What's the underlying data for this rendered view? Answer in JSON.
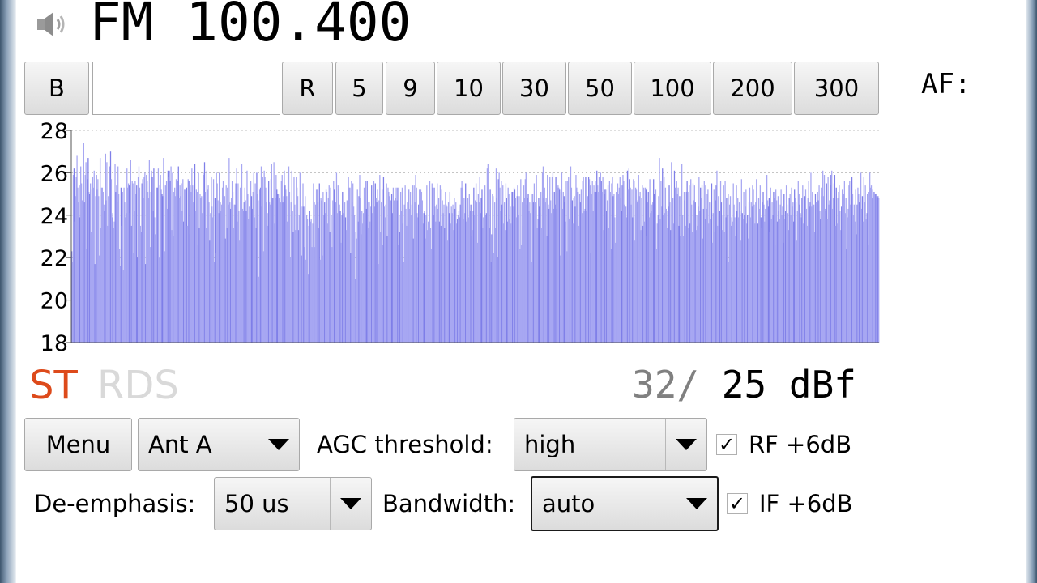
{
  "header": {
    "frequency": "FM 100.400",
    "af_label": "AF:"
  },
  "freq_bar": {
    "bands_label": "B",
    "frequency_input_value": "",
    "reset_label": "R",
    "steps": [
      "5",
      "9",
      "10",
      "30",
      "50",
      "100",
      "200",
      "300"
    ]
  },
  "chart_data": {
    "type": "bar",
    "ylim": [
      18,
      28
    ],
    "yticks": [
      "18",
      "20",
      "22",
      "24",
      "26",
      "28"
    ],
    "grid": true,
    "values": [
      22.3,
      21.8,
      25.9,
      26.2,
      23.7,
      24.9,
      25.8,
      26.8,
      25.3,
      24.6,
      25.4,
      23.9,
      26.3,
      25.5,
      24.7,
      22.7,
      27.4,
      24.6,
      25.9,
      26.5,
      22.4,
      25.7,
      26.7,
      25.1,
      25.0,
      25.5,
      23.2,
      25.2,
      25.8,
      25.3,
      26.1,
      21.7,
      24.9,
      25.9,
      25.2,
      25.7,
      24.9,
      22.1,
      26.7,
      23.4,
      25.3,
      25.3,
      25.1,
      24.5,
      24.2,
      26.9,
      24.7,
      26.5,
      23.5,
      24.9,
      25.2,
      26.3,
      27.0,
      25.7,
      23.9,
      24.1,
      23.4,
      23.7,
      26.4,
      25.1,
      25.4,
      24.6,
      26.3,
      25.0,
      22.4,
      21.6,
      25.3,
      23.5,
      25.1,
      21.4,
      25.3,
      24.6,
      23.9,
      24.1,
      26.2,
      25.3,
      25.5,
      25.4,
      24.1,
      26.6,
      23.5,
      25.6,
      25.5,
      22.2,
      24.2,
      25.6,
      25.0,
      25.4,
      22.0,
      25.8,
      26.3,
      25.3,
      23.5,
      23.2,
      25.5,
      25.7,
      24.8,
      25.8,
      26.0,
      21.7,
      25.9,
      25.6,
      25.1,
      24.8,
      26.6,
      22.5,
      25.1,
      26.1,
      25.8,
      24.2,
      26.2,
      23.9,
      23.1,
      25.0,
      25.3,
      25.3,
      26.2,
      22.0,
      25.4,
      25.9,
      25.2,
      25.0,
      24.9,
      26.7,
      25.4,
      22.3,
      25.4,
      25.6,
      24.3,
      26.1,
      25.8,
      26.1,
      25.6,
      26.3,
      23.3,
      26.0,
      23.0,
      25.1,
      25.3,
      24.9,
      25.7,
      24.3,
      25.6,
      26.3,
      24.8,
      25.4,
      24.9,
      25.5,
      24.2,
      25.7,
      23.7,
      25.2,
      25.2,
      24.3,
      25.3,
      23.5,
      25.7,
      25.6,
      23.1,
      25.4,
      25.1,
      26.2,
      25.4,
      24.6,
      25.7,
      26.4,
      24.2,
      25.2,
      25.1,
      22.6,
      26.0,
      23.4,
      25.0,
      24.8,
      24.9,
      24.1,
      26.0,
      25.9,
      26.5,
      25.1,
      23.4,
      26.1,
      25.2,
      25.4,
      24.6,
      22.8,
      24.1,
      25.8,
      24.4,
      23.9,
      25.7,
      21.8,
      24.8,
      22.2,
      26.0,
      25.5,
      24.7,
      24.1,
      26.0,
      24.6,
      24.2,
      24.5,
      25.3,
      25.6,
      24.2,
      24.9,
      22.9,
      25.4,
      23.4,
      25.3,
      24.5,
      26.7,
      24.6,
      24.3,
      24.8,
      25.6,
      25.1,
      23.4,
      24.5,
      24.5,
      25.5,
      26.2,
      23.7,
      25.5,
      24.2,
      22.8,
      25.3,
      25.4,
      26.4,
      24.3,
      24.2,
      24.6,
      25.3,
      24.7,
      24.2,
      26.1,
      25.0,
      23.8,
      24.4,
      25.2,
      25.6,
      24.9,
      24.3,
      25.1,
      26.0,
      23.9,
      25.5,
      23.4,
      26.0,
      25.0,
      24.7,
      21.1,
      25.2,
      25.3,
      26.3,
      24.4,
      25.8,
      22.3,
      26.1,
      25.8,
      25.3,
      24.6,
      24.1,
      23.5,
      25.6,
      24.6,
      24.5,
      25.7,
      26.4,
      24.8,
      24.8,
      26.5,
      23.6,
      24.8,
      25.9,
      25.2,
      25.0,
      25.0,
      24.8,
      21.3,
      24.6,
      25.6,
      25.9,
      24.6,
      24.9,
      26.1,
      25.4,
      25.2,
      24.9,
      23.7,
      25.9,
      26.3,
      25.1,
      22.0,
      24.6,
      26.1,
      24.2,
      23.2,
      25.8,
      24.5,
      23.3,
      25.8,
      25.3,
      24.9,
      23.3,
      24.0,
      26.0,
      25.5,
      22.1,
      24.4,
      25.5,
      24.4,
      22.5,
      24.9,
      21.9,
      24.0,
      23.8,
      21.2,
      23.5,
      24.2,
      23.7,
      23.8,
      22.5,
      23.6,
      25.5,
      24.6,
      22.5,
      24.5,
      25.2,
      25.2,
      24.6,
      23.4,
      25.5,
      21.9,
      24.8,
      24.7,
      22.1,
      25.1,
      24.0,
      24.6,
      24.1,
      25.2,
      25.1,
      23.6,
      24.8,
      25.4,
      23.2,
      25.3,
      24.0,
      22.5,
      24.7,
      25.6,
      25.2,
      23.6,
      24.6,
      26.0,
      24.1,
      25.4,
      25.2,
      24.5,
      24.2,
      22.7,
      24.0,
      25.1,
      24.1,
      21.8,
      24.6,
      23.9,
      23.3,
      24.7,
      24.6,
      25.8,
      25.3,
      25.3,
      22.2,
      25.6,
      24.6,
      25.5,
      24.4,
      24.0,
      21.0,
      23.2,
      22.9,
      25.2,
      23.7,
      24.9,
      25.9,
      24.8,
      23.1,
      24.2,
      23.6,
      24.1,
      25.3,
      22.6,
      25.6,
      24.3,
      25.6,
      24.6,
      23.4,
      24.6,
      23.7,
      24.4,
      25.4,
      24.1,
      22.4,
      25.6,
      24.4,
      25.5,
      24.8,
      24.6,
      25.2,
      21.7,
      24.7,
      25.9,
      23.2,
      24.6,
      25.2,
      22.6,
      25.8,
      24.4,
      23.9,
      24.5,
      25.5,
      23.0,
      25.3,
      25.1,
      24.9,
      23.1,
      24.7,
      25.0,
      24.1,
      25.3,
      24.7,
      23.7,
      24.8,
      25.3,
      24.7,
      25.3,
      22.6,
      24.0,
      23.2,
      25.1,
      24.2,
      25.3,
      23.6,
      21.8,
      24.5,
      25.4,
      24.3,
      23.5,
      24.6,
      25.2,
      25.2,
      24.3,
      25.1,
      24.0,
      24.5,
      25.4,
      22.9,
      25.4,
      24.6,
      25.9,
      25.3,
      24.1,
      23.9,
      24.5,
      25.2,
      21.6,
      25.2,
      25.1,
      24.7,
      23.6,
      24.1,
      24.2,
      22.9,
      24.0,
      25.4,
      23.3,
      23.7,
      23.6,
      25.6,
      23.4,
      22.4,
      25.5,
      25.3,
      24.0,
      25.3,
      24.4,
      23.7,
      24.5,
      25.5,
      24.3,
      24.8,
      23.7,
      25.4,
      23.5,
      25.2,
      24.7,
      24.1,
      24.5,
      23.4,
      25.1,
      24.5,
      24.4,
      22.8,
      24.6,
      24.1,
      25.1,
      23.6,
      24.4,
      24.1,
      24.5,
      23.3,
      24.8,
      24.3,
      24.6,
      23.6,
      23.8,
      24.0,
      24.2,
      23.9,
      24.5,
      25.3,
      25.6,
      25.3,
      23.8,
      24.8,
      24.1,
      25.5,
      23.7,
      23.8,
      24.8,
      23.9,
      25.0,
      24.2,
      24.5,
      23.0,
      23.3,
      24.2,
      25.3,
      24.0,
      24.7,
      25.5,
      24.6,
      22.7,
      25.0,
      24.6,
      25.8,
      24.1,
      24.8,
      25.2,
      23.4,
      23.9,
      25.1,
      25.4,
      24.0,
      24.1,
      26.2,
      26.4,
      23.8,
      23.4,
      25.2,
      21.8,
      23.1,
      25.0,
      24.9,
      22.2,
      24.6,
      23.4,
      26.2,
      24.8,
      22.0,
      25.7,
      26.0,
      25.3,
      24.2,
      25.6,
      24.5,
      25.4,
      23.6,
      24.6,
      23.3,
      25.5,
      24.8,
      23.7,
      25.3,
      25.0,
      23.8,
      24.4,
      23.6,
      25.1,
      25.1,
      24.4,
      25.3,
      25.2,
      24.8,
      23.9,
      24.9,
      25.4,
      24.0,
      24.9,
      22.4,
      25.7,
      22.6,
      24.6,
      23.5,
      25.4,
      24.8,
      25.7,
      26.0,
      24.5,
      24.8,
      25.0,
      24.2,
      24.6,
      24.1,
      25.0,
      21.8,
      25.0,
      24.6,
      25.5,
      24.6,
      24.2,
      25.9,
      23.4,
      23.8,
      24.8,
      24.4,
      24.1,
      25.1,
      23.4,
      26.0,
      26.3,
      24.8,
      25.3,
      24.6,
      24.8,
      23.0,
      25.9,
      24.5,
      24.3,
      25.8,
      24.7,
      24.1,
      25.8,
      26.0,
      24.3,
      25.1,
      24.5,
      25.8,
      24.3,
      25.3,
      25.4,
      25.3,
      25.2,
      22.1,
      25.1,
      26.0,
      24.3,
      25.1,
      24.9,
      24.6,
      23.7,
      25.6,
      22.3,
      25.6,
      25.8,
      23.8,
      23.9,
      26.3,
      25.3,
      24.7,
      23.6,
      24.8,
      24.9,
      24.4,
      25.9,
      25.3,
      25.1,
      25.1,
      23.5,
      25.0,
      24.6,
      25.2,
      24.1,
      25.6,
      25.8,
      24.2,
      24.3,
      25.8,
      24.2,
      21.3,
      24.9,
      25.8,
      25.7,
      25.4,
      22.2,
      25.0,
      25.6,
      24.2,
      25.4,
      25.1,
      25.6,
      25.1,
      26.1,
      25.4,
      25.1,
      25.8,
      24.8,
      26.0,
      25.6,
      25.1,
      25.8,
      23.3,
      25.0,
      25.2,
      25.2,
      24.2,
      24.7,
      25.4,
      23.4,
      25.6,
      25.1,
      22.4,
      25.5,
      25.8,
      24.9,
      25.0,
      23.9,
      22.7,
      25.1,
      24.9,
      25.5,
      25.0,
      25.3,
      25.8,
      24.8,
      24.2,
      25.4,
      25.9,
      25.6,
      24.5,
      23.1,
      24.4,
      23.9,
      26.1,
      25.2,
      26.2,
      25.7,
      25.3,
      24.5,
      25.2,
      23.9,
      25.7,
      25.6,
      22.8,
      25.3,
      25.2,
      24.6,
      24.7,
      25.9,
      24.9,
      25.1,
      23.3,
      24.8,
      25.4,
      23.5,
      25.3,
      23.7,
      25.3,
      25.2,
      23.0,
      24.6,
      25.1,
      23.9,
      25.7,
      24.1,
      24.2,
      24.5,
      24.6,
      25.7,
      25.0,
      23.9,
      25.2,
      22.4,
      23.6,
      24.0,
      24.9,
      26.7,
      23.8,
      25.6,
      24.4,
      26.2,
      24.0,
      25.8,
      24.1,
      25.3,
      24.3,
      23.4,
      24.2,
      24.4,
      25.4,
      24.6,
      23.3,
      26.5,
      24.2,
      24.8,
      23.6,
      26.1,
      25.3,
      24.7,
      25.6,
      25.0,
      25.3,
      23.5,
      24.9,
      23.0,
      25.2,
      26.4,
      24.0,
      23.0,
      25.1,
      24.7,
      23.5,
      25.1,
      25.6,
      25.1,
      23.4,
      25.4,
      23.6,
      25.7,
      24.5,
      23.2,
      25.5,
      24.7,
      25.4,
      24.6,
      23.3,
      24.0,
      23.5,
      24.4,
      25.8,
      24.2,
      25.3,
      24.8,
      25.4,
      22.9,
      24.3,
      25.6,
      23.8,
      25.4,
      24.3,
      25.0,
      25.2,
      23.6,
      24.6,
      23.8,
      24.6,
      25.5,
      22.7,
      24.1,
      25.2,
      23.2,
      24.7,
      25.4,
      26.1,
      23.5,
      24.9,
      22.9,
      24.2,
      25.6,
      24.6,
      23.3,
      24.0,
      25.4,
      23.2,
      25.6,
      23.9,
      24.8,
      24.0,
      25.0,
      21.8,
      24.5,
      24.9,
      23.5,
      23.9,
      23.7,
      25.5,
      24.5,
      23.9,
      23.0,
      25.4,
      24.2,
      24.8,
      23.9,
      24.6,
      24.2,
      22.8,
      25.7,
      24.1,
      23.8,
      25.1,
      24.0,
      24.4,
      25.2,
      23.6,
      24.0,
      22.9,
      24.6,
      25.3,
      23.9,
      24.6,
      24.4,
      25.4,
      25.2,
      24.5,
      23.6,
      24.6,
      25.7,
      23.2,
      23.6,
      24.8,
      24.3,
      25.4,
      23.9,
      23.4,
      24.6,
      25.1,
      24.5,
      23.7,
      24.3,
      24.0,
      25.9,
      24.7,
      24.4,
      24.8,
      23.2,
      25.3,
      23.8,
      24.6,
      24.0,
      25.1,
      24.8,
      22.6,
      25.2,
      24.7,
      23.7,
      24.9,
      24.2,
      23.8,
      24.5,
      25.2,
      24.0,
      24.4,
      22.7,
      25.0,
      23.8,
      24.2,
      25.4,
      24.5,
      24.1,
      23.3,
      24.8,
      25.0,
      24.0,
      25.3,
      24.4,
      24.6,
      23.7,
      25.2,
      24.8,
      24.6,
      22.8,
      24.2,
      25.6,
      25.0,
      24.5,
      24.1,
      23.9,
      24.8,
      25.4,
      23.6,
      24.7,
      24.9,
      25.2,
      24.3,
      23.5,
      24.8,
      25.6,
      24.4,
      24.6,
      26.0,
      24.4,
      25.1,
      23.8,
      24.5,
      23.2,
      25.0,
      24.6,
      23.0,
      25.1,
      24.7,
      25.4,
      24.2,
      23.8,
      24.9,
      25.3,
      26.1,
      24.9,
      25.9,
      24.3,
      24.2,
      25.5,
      23.8,
      25.8,
      24.5,
      24.7,
      25.4,
      25.9,
      26.1,
      24.3,
      24.8,
      25.5,
      25.9,
      23.5,
      25.3,
      23.6,
      24.8,
      25.1,
      25.4,
      24.2,
      23.3,
      24.4,
      25.2,
      24.9,
      25.0,
      25.6,
      24.1,
      24.8,
      22.4,
      23.9,
      24.3,
      25.4,
      25.6,
      24.5,
      24.1,
      25.8,
      25.0,
      24.0,
      24.5,
      23.7,
      25.2,
      23.1,
      24.5,
      25.3,
      25.0,
      24.6,
      25.8,
      26.0,
      24.3,
      24.9,
      23.7,
      25.8,
      24.6,
      25.4,
      23.8,
      24.1,
      25.0,
      22.6,
      25.1,
      26.0,
      25.3,
      25.4,
      24.8,
      25.2,
      25.1,
      25.1,
      25.0,
      25.0,
      24.9,
      24.8,
      24.9,
      24.8
    ]
  },
  "indicators": {
    "stereo": "ST",
    "rds": "RDS",
    "signal_peak": "32/",
    "signal_current": "25 dBf",
    "stereo_color": "#dd4a1b",
    "rds_color": "#d9d9d9",
    "bar_color": "#a7a7f2",
    "bar_color_strong": "#7f7fe8"
  },
  "controls": {
    "menu_label": "Menu",
    "antenna_value": "Ant A",
    "agc_label": "AGC threshold:",
    "agc_value": "high",
    "rf_label": "RF +6dB",
    "rf_checked": true,
    "deemphasis_label": "De-emphasis:",
    "deemphasis_value": "50 us",
    "bandwidth_label": "Bandwidth:",
    "bandwidth_value": "auto",
    "if_label": "IF +6dB",
    "if_checked": true,
    "check_glyph": "✓"
  }
}
